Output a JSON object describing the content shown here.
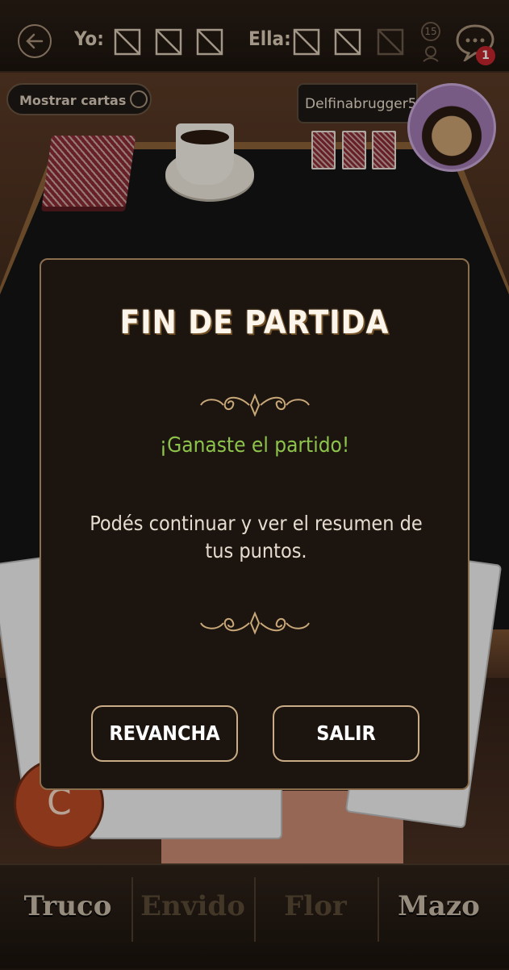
{
  "header": {
    "back_icon": "arrow-left-icon",
    "my_score_label": "Yo:",
    "opponent_score_label": "Ella:",
    "rose_count": "15",
    "chat_badge": "1"
  },
  "table": {
    "show_cards_label": "Mostrar cartas",
    "opponent_name": "Delfinabrugger5",
    "c_button_label": "C"
  },
  "modal": {
    "title": "FIN DE PARTIDA",
    "result": "¡Ganaste el partido!",
    "message": "Podés continuar y ver el resumen de tus puntos.",
    "rematch_label": "REVANCHA",
    "exit_label": "SALIR"
  },
  "actions": {
    "truco": "Truco",
    "envido": "Envido",
    "flor": "Flor",
    "mazo": "Mazo"
  },
  "colors": {
    "result": "#8cc34a",
    "badge": "#c0262c",
    "modal_bg": "#1c140f"
  }
}
